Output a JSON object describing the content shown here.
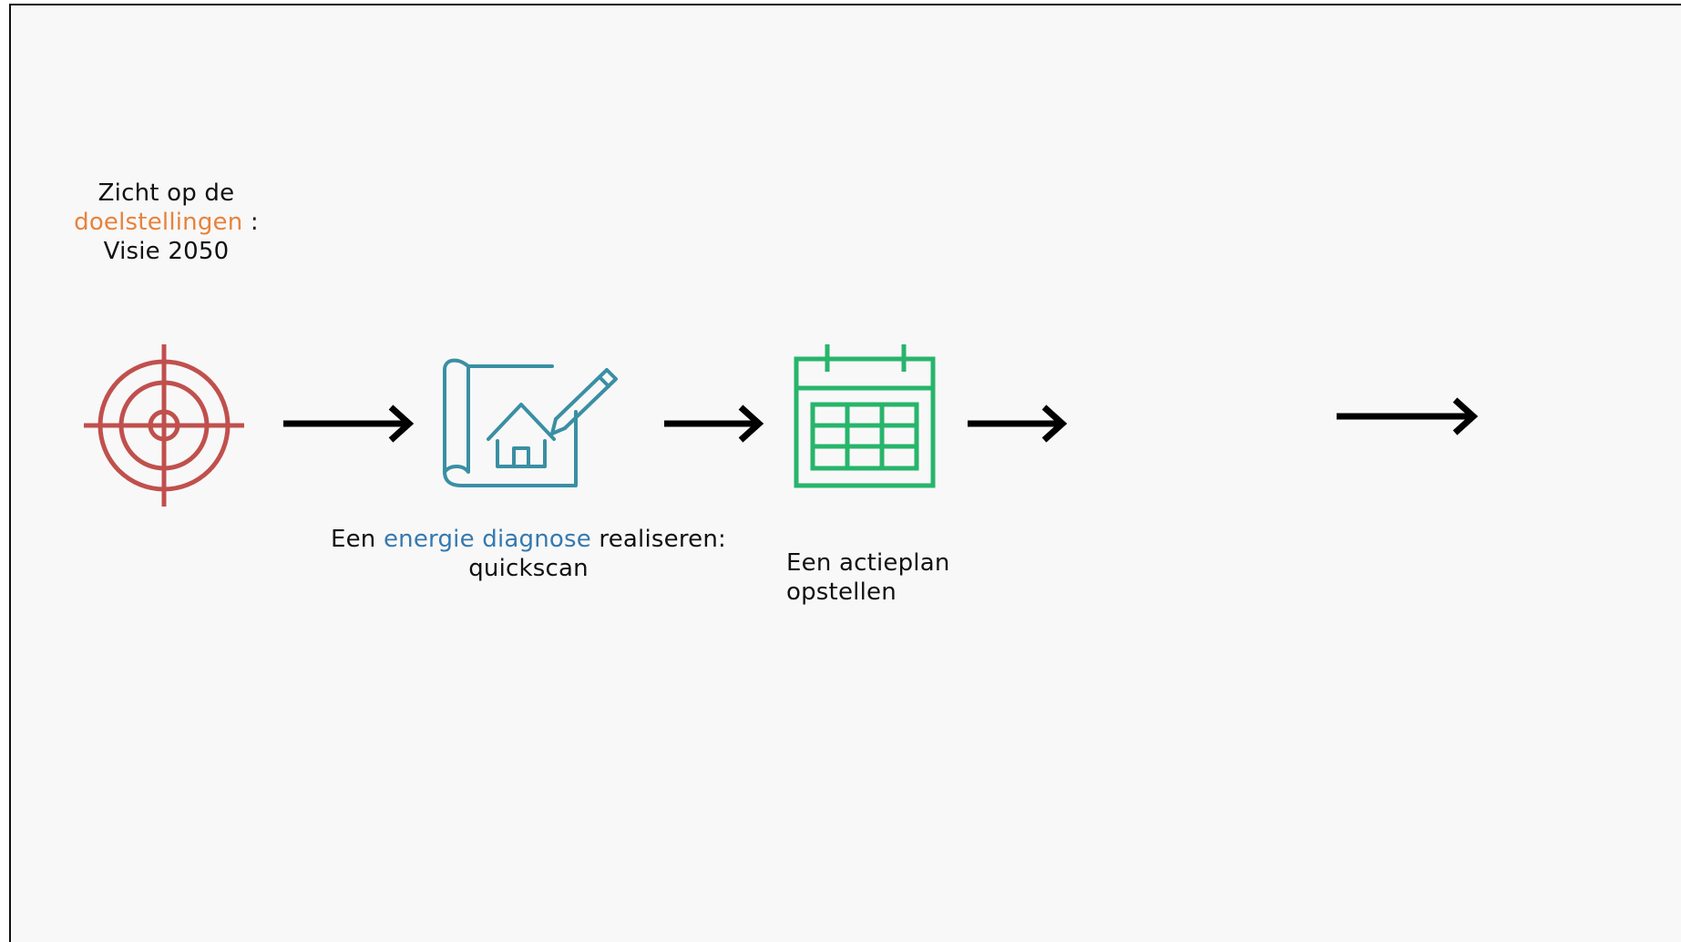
{
  "colors": {
    "target": "#c0504d",
    "blueprint": "#3a8fa3",
    "calendar": "#27b56b",
    "highlight_orange": "#e8823c",
    "highlight_blue": "#3579b0",
    "arrow": "#000000"
  },
  "steps": [
    {
      "icon": "target-icon",
      "caption": {
        "line1": "Zicht op de",
        "highlight": "doelstellingen",
        "suffix": " :",
        "line3": "Visie 2050"
      }
    },
    {
      "icon": "blueprint-house-pencil-icon",
      "caption": {
        "prefix": "Een ",
        "highlight": "energie diagnose",
        "suffix": " realiseren:",
        "line2": "quickscan"
      }
    },
    {
      "icon": "calendar-icon",
      "caption": {
        "line1": "Een actieplan",
        "line2": "opstellen"
      }
    }
  ]
}
